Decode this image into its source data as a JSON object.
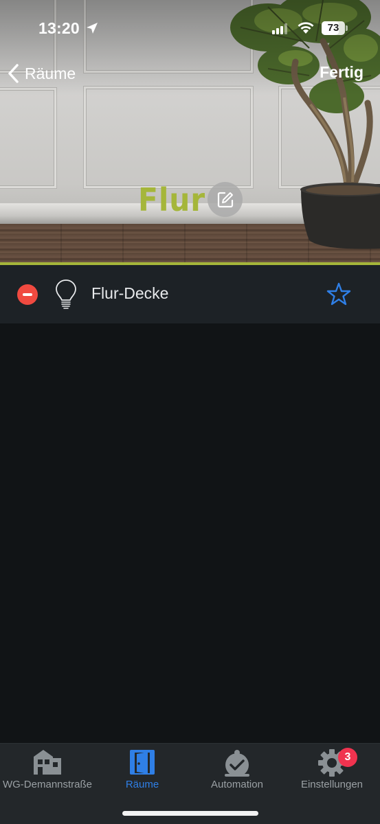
{
  "status_bar": {
    "time": "13:20",
    "battery_percent": "73",
    "battery_level": 0.73
  },
  "nav": {
    "back_label": "Räume",
    "done_label": "Fertig"
  },
  "room": {
    "title": "Flur",
    "accent_color": "#a5b63a"
  },
  "devices": [
    {
      "name": "Flur-Decke",
      "icon": "lightbulb-icon",
      "favorite_icon": "star-icon"
    }
  ],
  "tabbar": {
    "tabs": [
      {
        "label": "WG-Demannstraße",
        "icon": "home-icon",
        "active": false
      },
      {
        "label": "Räume",
        "icon": "door-icon",
        "active": true
      },
      {
        "label": "Automation",
        "icon": "alarm-clock-icon",
        "active": false
      },
      {
        "label": "Einstellungen",
        "icon": "gear-icon",
        "active": false,
        "badge": "3"
      }
    ],
    "active_color": "#2f7fe6"
  }
}
